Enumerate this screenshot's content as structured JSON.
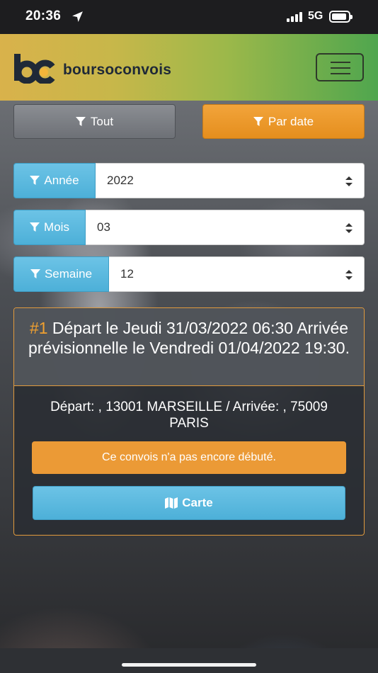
{
  "status_bar": {
    "time": "20:36",
    "network": "5G",
    "icons": [
      "location-arrow-icon",
      "signal-icon",
      "battery-icon"
    ]
  },
  "navbar": {
    "brand": "boursoconvois",
    "logo_icon": "bc-logo-icon",
    "menu_icon": "hamburger-icon",
    "colors": {
      "gradient_start": "#d9b24b",
      "gradient_end": "#4fa64e"
    }
  },
  "filters": {
    "all_label": "Tout",
    "by_date_label": "Par date",
    "icon": "filter-icon",
    "active": "Par date",
    "colors": {
      "active": "#e58e1d",
      "inactive": "#6d7076",
      "label_bg": "#4db0d8"
    }
  },
  "selects": {
    "year": {
      "label": "Année",
      "value": "2022"
    },
    "month": {
      "label": "Mois",
      "value": "03"
    },
    "week": {
      "label": "Semaine",
      "value": "12"
    }
  },
  "convoy": {
    "number": "#1",
    "title": "Départ le Jeudi 31/03/2022 06:30 Arrivée prévisionnelle le Vendredi 01/04/2022 19:30.",
    "route": "Départ: , 13001 MARSEILLE / Arrivée: , 75009 PARIS",
    "status": "Ce convois n'a pas encore débuté.",
    "map_button": "Carte",
    "map_icon": "map-icon",
    "colors": {
      "accent": "#f0a030",
      "status_bg": "#eb9a36",
      "border": "#e09a3e"
    }
  }
}
